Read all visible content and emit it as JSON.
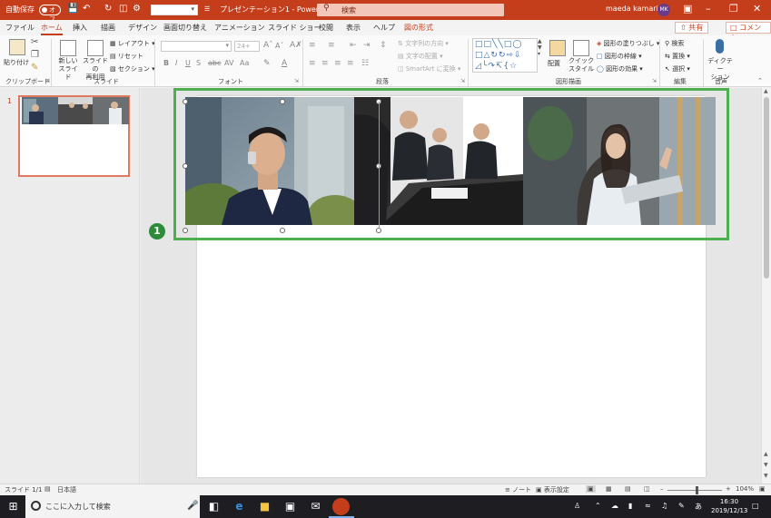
{
  "titlebar": {
    "autosave_label": "自動保存",
    "autosave_state": "オフ",
    "font_box_value": "",
    "document_title": "プレゼンテーション1 - PowerPo...",
    "search_placeholder": "検索",
    "user_name": "maeda kamari",
    "user_initials": "MK"
  },
  "tabs": [
    "ファイル",
    "ホーム",
    "挿入",
    "描画",
    "デザイン",
    "画面切り替え",
    "アニメーション",
    "スライド ショー",
    "校閲",
    "表示",
    "ヘルプ",
    "図の形式"
  ],
  "share_label": "共有",
  "comment_label": "コメント",
  "ribbon": {
    "clipboard": {
      "paste": "貼り付け",
      "group": "クリップボード"
    },
    "slides": {
      "new_slide": "新しい\nスライド",
      "reuse": "スライドの\n再利用",
      "layout": "レイアウト",
      "reset": "リセット",
      "section": "セクション",
      "group": "スライド"
    },
    "font": {
      "font_name": "",
      "font_size": "24+",
      "group": "フォント"
    },
    "paragraph": {
      "text_direction": "文字列の方向",
      "align_text": "文字の配置",
      "smartart": "SmartArt に変換",
      "group": "段落"
    },
    "drawing": {
      "arrange": "配置",
      "quick_styles": "クイック\nスタイル",
      "shape_fill": "図形の塗りつぶし",
      "shape_outline": "図形の枠線",
      "shape_effects": "図形の効果",
      "group": "図形描画"
    },
    "editing": {
      "find": "検索",
      "replace": "置換",
      "select": "選択",
      "group": "編集"
    },
    "voice": {
      "dictate": "ディクテー\nション",
      "group": "音声"
    }
  },
  "thumbnail": {
    "number": "1"
  },
  "marker": "1",
  "statusbar": {
    "slide_indicator": "スライド 1/1",
    "language": "日本語",
    "notes": "ノート",
    "display_settings": "表示設定",
    "zoom": "104%"
  },
  "taskbar": {
    "search_placeholder": "ここに入力して検索",
    "ime": "あ",
    "time": "16:30",
    "date": "2019/12/13"
  },
  "colors": {
    "accent": "#c43e1c",
    "highlight_box": "#4caf50",
    "marker": "#2e8b3a"
  }
}
